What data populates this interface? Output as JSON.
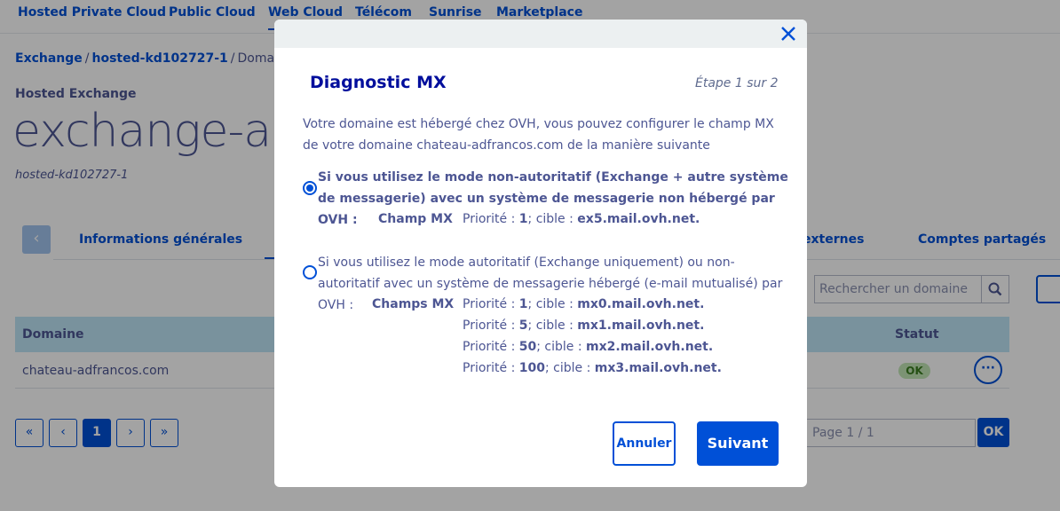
{
  "topnav": {
    "items": [
      {
        "label": "Hosted Private Cloud"
      },
      {
        "label": "Public Cloud"
      },
      {
        "label": "Web Cloud",
        "active": true
      },
      {
        "label": "Télécom"
      },
      {
        "label": "Sunrise"
      },
      {
        "label": "Marketplace"
      }
    ]
  },
  "breadcrumb": {
    "items": [
      "Exchange",
      "hosted-kd102727-1",
      "Domaines"
    ],
    "separator": "/"
  },
  "header": {
    "product": "Hosted Exchange",
    "title": "exchange-adf",
    "subtitle": "hosted-kd102727-1"
  },
  "tabs": {
    "prev_icon": "chevron-left-icon",
    "items": [
      "Informations générales",
      "externes",
      "Comptes partagés"
    ]
  },
  "search": {
    "placeholder": "Rechercher un domaine",
    "icon": "search-icon"
  },
  "table": {
    "headers": [
      "Domaine",
      "Statut"
    ],
    "rows": [
      {
        "domain": "chateau-adfrancos.com",
        "status": "OK",
        "status_color": "#c2e6b6"
      }
    ],
    "row_action_icon": "more-horizontal-icon"
  },
  "pagination": {
    "first": "«",
    "prev": "‹",
    "current": "1",
    "next": "›",
    "last": "»",
    "page_input_placeholder": "Page 1 / 1",
    "ok_label": "OK"
  },
  "modal": {
    "title": "Diagnostic MX",
    "step": "Étape 1 sur 2",
    "close_icon": "close-icon",
    "intro": "Votre domaine est hébergé chez OVH, vous pouvez configurer le champ MX de votre domaine chateau-adfrancos.com de la manière suivante",
    "option1": {
      "selected": true,
      "text": "Si vous utilisez le mode non-autoritatif (Exchange + autre système de messagerie) avec un système de messagerie non hébergé par OVH :",
      "mx_label": "Champ MX",
      "records": [
        {
          "priority_label": "Priorité :",
          "priority": "1",
          "target_label": "; cible :",
          "target": "ex5.mail.ovh.net."
        }
      ]
    },
    "option2": {
      "selected": false,
      "text": "Si vous utilisez le mode autoritatif (Exchange uniquement) ou non-autoritatif avec un système de messagerie hébergé (e-mail mutualisé) par OVH :",
      "mx_label": "Champs MX",
      "records": [
        {
          "priority_label": "Priorité :",
          "priority": "1",
          "target_label": "; cible :",
          "target": "mx0.mail.ovh.net."
        },
        {
          "priority_label": "Priorité :",
          "priority": "5",
          "target_label": "; cible :",
          "target": "mx1.mail.ovh.net."
        },
        {
          "priority_label": "Priorité :",
          "priority": "50",
          "target_label": "; cible :",
          "target": "mx2.mail.ovh.net."
        },
        {
          "priority_label": "Priorité :",
          "priority": "100",
          "target_label": "; cible :",
          "target": "mx3.mail.ovh.net."
        }
      ]
    },
    "cancel_label": "Annuler",
    "next_label": "Suivant"
  },
  "colors": {
    "primary": "#0050d7",
    "text": "#4d5693",
    "table_header_bg": "#bee5f6",
    "modal_header_bg": "#ecf0f1"
  }
}
